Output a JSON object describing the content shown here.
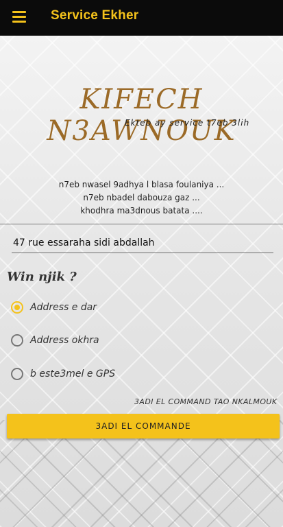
{
  "appbar": {
    "title": "Service Ekher",
    "menu_icon": "hamburger-menu-icon"
  },
  "hero": {
    "title": "KIFECH N3AWNOUK",
    "subtitle": "Ekteb ay service t7eb 3lih"
  },
  "examples": [
    "n7eb nwasel 9adhya l blasa foulaniya ...",
    "n7eb nbadel dabouza gaz ...",
    "khodhra ma3dnous batata ...."
  ],
  "address": {
    "value": "47 rue essaraha sidi abdallah"
  },
  "location": {
    "title": "Win njik ?",
    "options": [
      {
        "label": "Address e dar",
        "selected": true
      },
      {
        "label": "Address okhra",
        "selected": false
      },
      {
        "label": "b este3mel e GPS",
        "selected": false
      }
    ]
  },
  "command": {
    "hint": "3ADI EL COMMAND TAO NKALMOUK",
    "button_label": "3ADI EL COMMANDE"
  },
  "colors": {
    "accent": "#f4c21b",
    "title_brown": "#9b6a27",
    "appbar": "#0b0b0b"
  }
}
